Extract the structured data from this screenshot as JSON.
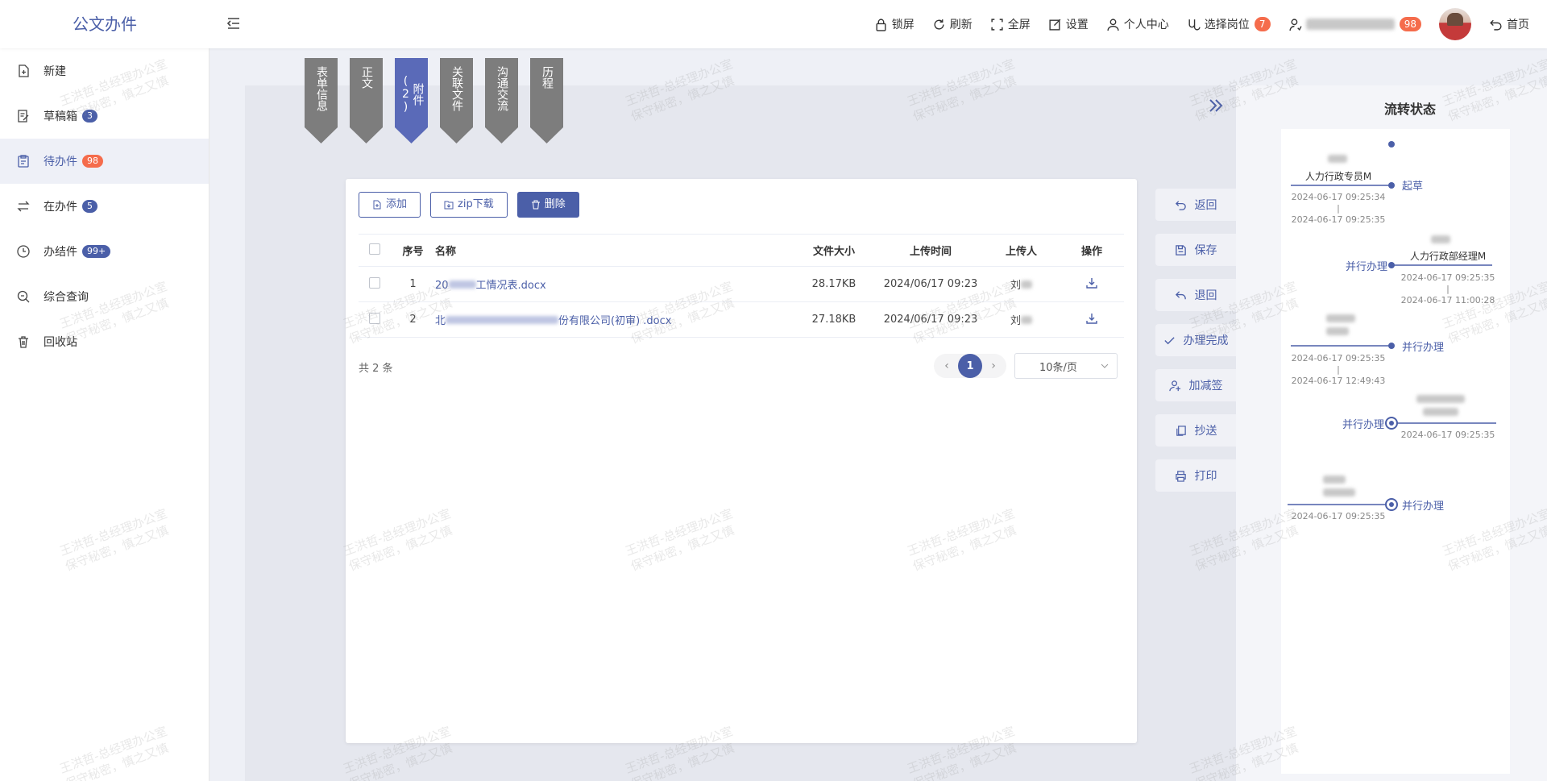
{
  "app": {
    "title": "公文办件"
  },
  "header": {
    "lock": "锁屏",
    "refresh": "刷新",
    "fullscreen": "全屏",
    "settings": "设置",
    "profile": "个人中心",
    "select_post": "选择岗位",
    "select_post_count": "7",
    "user_count": "98",
    "home": "首页"
  },
  "sidebar": {
    "items": [
      {
        "label": "新建",
        "badge": ""
      },
      {
        "label": "草稿箱",
        "badge": "3"
      },
      {
        "label": "待办件",
        "badge": "98"
      },
      {
        "label": "在办件",
        "badge": "5"
      },
      {
        "label": "办结件",
        "badge": "99+"
      },
      {
        "label": "综合查询",
        "badge": ""
      },
      {
        "label": "回收站",
        "badge": ""
      }
    ]
  },
  "tabs": [
    {
      "label": "表单信息"
    },
    {
      "label": "正文"
    },
    {
      "label": "附件(2)"
    },
    {
      "label": "关联文件"
    },
    {
      "label": "沟通交流"
    },
    {
      "label": "历程"
    }
  ],
  "attachments": {
    "buttons": {
      "add": "添加",
      "zip": "zip下载",
      "delete": "删除"
    },
    "columns": {
      "index": "序号",
      "name": "名称",
      "size": "文件大小",
      "time": "上传时间",
      "uploader": "上传人",
      "action": "操作"
    },
    "rows": [
      {
        "index": "1",
        "name_prefix": "20",
        "name_suffix": "工情况表.docx",
        "size": "28.17KB",
        "time": "2024/06/17 09:23",
        "uploader": "刘"
      },
      {
        "index": "2",
        "name_prefix": "北",
        "name_suffix": "份有限公司(初审) .docx",
        "size": "27.18KB",
        "time": "2024/06/17 09:23",
        "uploader": "刘"
      }
    ],
    "total": "共 2 条",
    "page": "1",
    "page_size": "10条/页"
  },
  "actions": [
    {
      "label": "返回",
      "icon": "return-icon"
    },
    {
      "label": "保存",
      "icon": "save-icon"
    },
    {
      "label": "退回",
      "icon": "send-back-icon"
    },
    {
      "label": "办理完成",
      "icon": "check-icon"
    },
    {
      "label": "加减签",
      "icon": "user-add-icon"
    },
    {
      "label": "抄送",
      "icon": "copy-icon"
    },
    {
      "label": "打印",
      "icon": "print-icon"
    }
  ],
  "flow": {
    "title": "流转状态",
    "nodes": [
      {
        "side": "left",
        "role": "人力行政专员M",
        "action": "起草",
        "t1": "2024-06-17 09:25:34",
        "t2": "2024-06-17 09:25:35"
      },
      {
        "side": "right",
        "role": "人力行政部经理M",
        "action": "并行办理",
        "t1": "2024-06-17 09:25:35",
        "t2": "2024-06-17 11:00:28"
      },
      {
        "side": "left",
        "role": "",
        "action": "并行办理",
        "t1": "2024-06-17 09:25:35",
        "t2": "2024-06-17 12:49:43"
      },
      {
        "side": "right",
        "role": "",
        "action": "并行办理",
        "t1": "2024-06-17 09:25:35",
        "t2": ""
      },
      {
        "side": "left",
        "role": "",
        "action": "并行办理",
        "t1": "2024-06-17 09:25:35",
        "t2": ""
      }
    ]
  },
  "watermark": {
    "line1": "王洪哲-总经理办公室",
    "line2": "保守秘密，慎之又慎"
  },
  "colors": {
    "primary": "#4b5fa8",
    "badge_red": "#f56c4c",
    "tab_gray": "#7d7d7d"
  }
}
